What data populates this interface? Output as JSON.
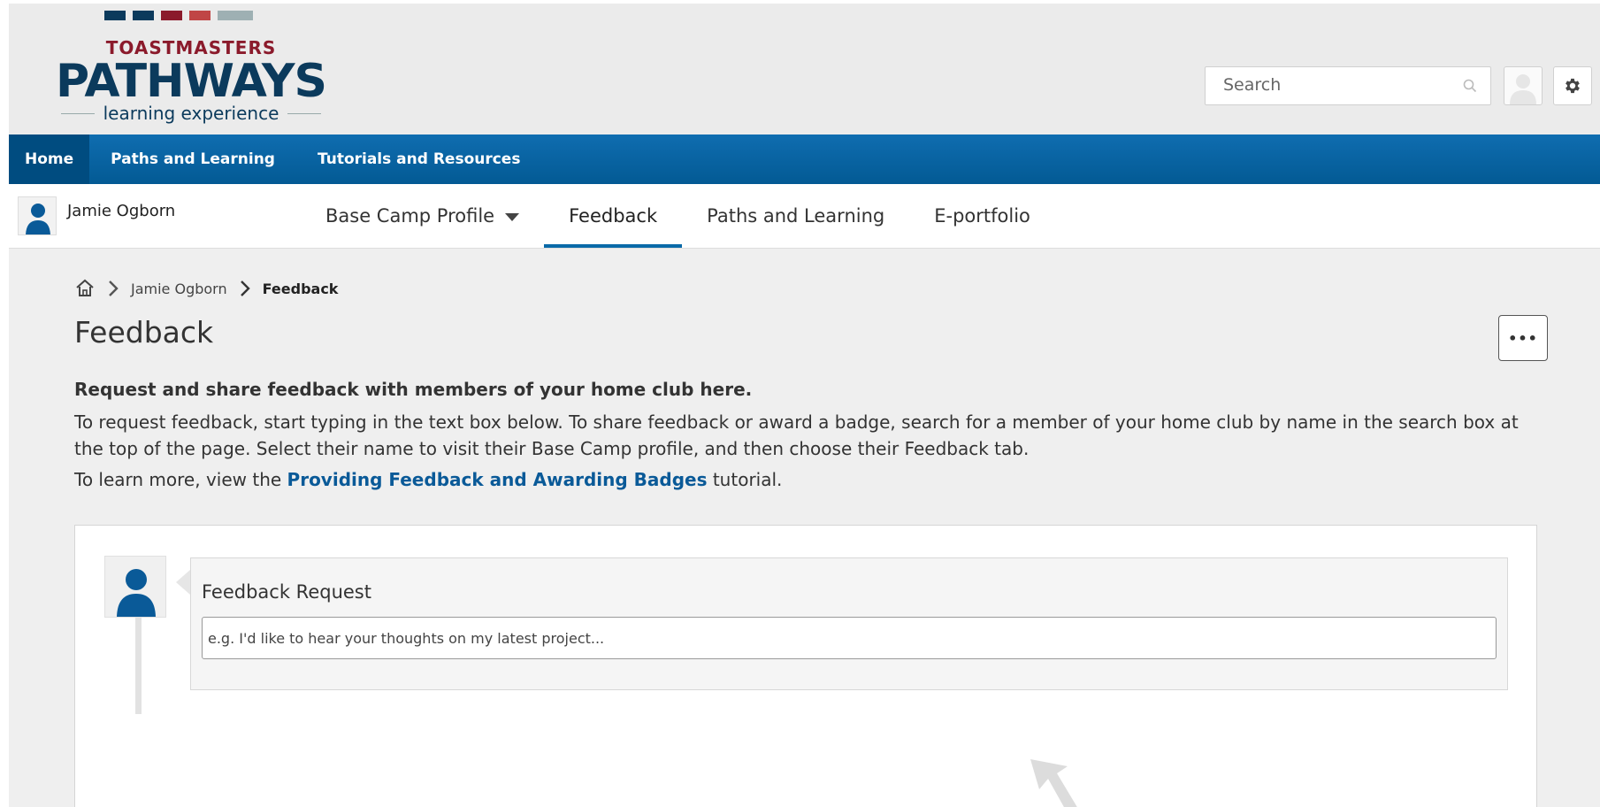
{
  "brand": {
    "logo_top": "TOASTMASTERS",
    "logo_main": "PATHWAYS",
    "logo_sub": "learning experience",
    "colors": {
      "navy": "#0b3a5c",
      "maroon": "#8b1a2b",
      "red": "#b33a3a",
      "grey": "#9eb0b3"
    }
  },
  "header": {
    "search_placeholder": "Search",
    "search_icon": "search-icon",
    "avatar_icon": "user-avatar-icon",
    "settings_icon": "gear-icon"
  },
  "nav": {
    "items": [
      {
        "label": "Home",
        "active": true
      },
      {
        "label": "Paths and Learning"
      },
      {
        "label": "Tutorials and Resources"
      }
    ]
  },
  "subnav": {
    "user_name": "Jamie Ogborn",
    "tabs": [
      {
        "label": "Base Camp Profile",
        "dropdown": true
      },
      {
        "label": "Feedback",
        "active": true
      },
      {
        "label": "Paths and Learning"
      },
      {
        "label": "E-portfolio"
      }
    ]
  },
  "breadcrumb": {
    "home_icon": "home-icon",
    "user": "Jamie Ogborn",
    "current": "Feedback"
  },
  "page": {
    "title": "Feedback",
    "more_label": "•••",
    "intro_bold": "Request and share feedback with members of your home club here.",
    "intro_para": "To request feedback, start typing in the text box below. To share feedback or award a badge, search for a member of your home club by name in the search box at the top of the page. Select their name to visit their Base Camp profile, and then choose their Feedback tab.",
    "learn_prefix": "To learn more, view the ",
    "learn_link": "Providing Feedback and Awarding Badges",
    "learn_suffix": " tutorial."
  },
  "feedback_request": {
    "title": "Feedback Request",
    "placeholder": "e.g. I'd like to hear your thoughts on my latest project..."
  },
  "accent": "#0a6aa8"
}
